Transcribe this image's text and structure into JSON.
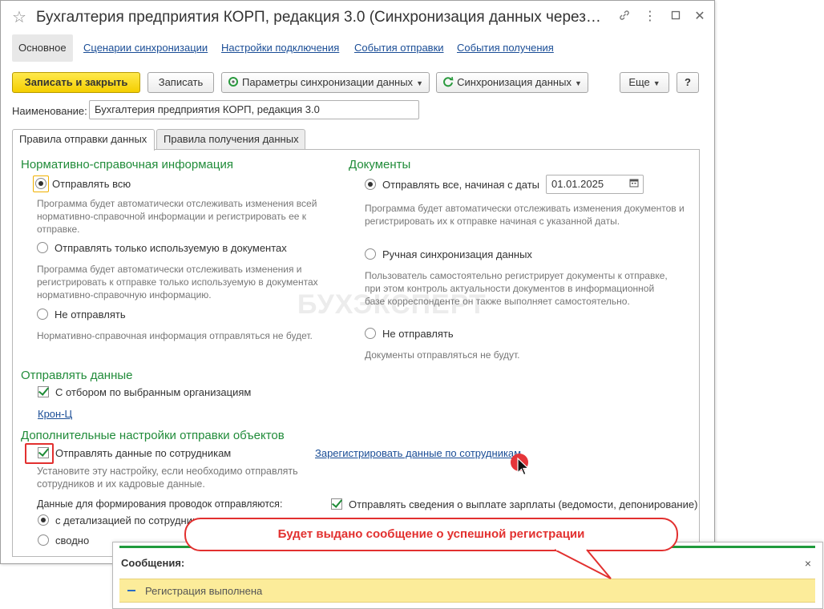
{
  "window": {
    "title": "Бухгалтерия предприятия КОРП, редакция 3.0 (Синхронизация данных через ..."
  },
  "nav_tabs": [
    {
      "label": "Основное"
    },
    {
      "label": "Сценарии синхронизации"
    },
    {
      "label": "Настройки подключения"
    },
    {
      "label": "События отправки"
    },
    {
      "label": "События получения"
    }
  ],
  "toolbar": {
    "save_close": "Записать и закрыть",
    "save": "Записать",
    "sync_params": "Параметры синхронизации данных",
    "sync_data": "Синхронизация данных",
    "more": "Еще",
    "help": "?"
  },
  "name_field": {
    "label": "Наименование:",
    "value": "Бухгалтерия предприятия КОРП, редакция 3.0"
  },
  "form_tabs": [
    {
      "label": "Правила отправки данных"
    },
    {
      "label": "Правила получения данных"
    }
  ],
  "nsi": {
    "heading": "Нормативно-справочная информация",
    "opt_all": "Отправлять всю",
    "opt_all_desc": "Программа будет автоматически отслеживать изменения всей нормативно-справочной информации и регистрировать ее к отправке.",
    "opt_used": "Отправлять только используемую в документах",
    "opt_used_desc": "Программа будет автоматически отслеживать изменения и регистрировать к отправке только используемую в документах нормативно-справочную информацию.",
    "opt_none": "Не отправлять",
    "opt_none_desc": "Нормативно-справочная информация отправляться не будет."
  },
  "docs": {
    "heading": "Документы",
    "opt_from_date": "Отправлять все, начиная с даты",
    "date_value": "01.01.2025",
    "opt_from_date_desc": "Программа будет автоматически отслеживать изменения документов и регистрировать их к отправке начиная с указанной даты.",
    "opt_manual": "Ручная синхронизация данных",
    "opt_manual_desc": "Пользователь самостоятельно регистрирует документы к отправке, при этом контроль актуальности документов в информационной базе корреспонденте он также выполняет самостоятельно.",
    "opt_none": "Не отправлять",
    "opt_none_desc": "Документы отправляться не будут."
  },
  "send_data": {
    "heading": "Отправлять данные",
    "filter_label": "С отбором по выбранным организациям",
    "org_link": "Крон-Ц"
  },
  "extra": {
    "heading": "Дополнительные настройки отправки объектов",
    "employees_label": "Отправлять данные по сотрудникам",
    "register_link": "Зарегистрировать данные по сотрудникам",
    "employees_desc": "Установите эту настройку, если необходимо отправлять сотрудников и их кадровые данные.",
    "postings_label": "Данные для формирования проводок отправляются:",
    "salary_label": "Отправлять сведения о выплате зарплаты (ведомости, депонирование)",
    "opt_detail": "с детализацией по сотрудникам",
    "opt_summary": "сводно"
  },
  "watermark": "БУХЭКСПЕРТ",
  "messages": {
    "title": "Сообщения:",
    "text": "Регистрация выполнена",
    "close": "×"
  },
  "callout": "Будет выдано сообщение о успешной регистрации",
  "colors": {
    "accent_green": "#218c3a",
    "link_blue": "#1a4d96",
    "primary_yellow": "#f4ce00",
    "highlight_red": "#e2302f",
    "message_yellow": "#fcec9a"
  }
}
